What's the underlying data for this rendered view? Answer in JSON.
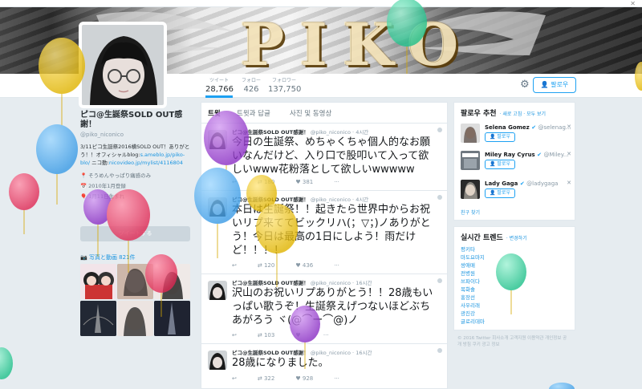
{
  "profile": {
    "name": "ピコ@生誕祭SOLD OUT感謝！",
    "handle": "@piko_niconico",
    "bio": "3/11ピコ生誕祭2016横SOLD OUT！ありがとう！！オフィシャルblog:",
    "bio_link1": "s.ameblo.jp/piko-blo/",
    "bio_mid": " ニコ動:",
    "bio_link2": "nicovideo.jp/mylist/4116804",
    "location": "そうめんやっぱり痛感のみ",
    "join": "2010年1月登録",
    "birth": "1月11日生まれ",
    "tweet_to_button": "ツイートする",
    "photos_label": "写真と動画 821件"
  },
  "banner": {
    "logo_text": "PIKO"
  },
  "stats": [
    {
      "label": "ツイート",
      "value": "28,766"
    },
    {
      "label": "フォロー",
      "value": "426"
    },
    {
      "label": "フォロワー",
      "value": "137,750"
    }
  ],
  "header_actions": {
    "follow_label": "팔로우"
  },
  "tabs": [
    "트윗",
    "트윗과 답글",
    "사진 및 동영상"
  ],
  "tweets": [
    {
      "name": "ピコ@生誕祭SOLD OUT感謝！",
      "handle": "@piko_niconico",
      "time": "4시간",
      "text": "今日の生誕祭、めちゃくちゃ個人的なお願いなんだけど、入り口で股叩いて入って欲しいwww花粉落として欲しいwwwww",
      "retweets": "180",
      "likes": "381"
    },
    {
      "name": "ピコ@生誕祭SOLD OUT感謝！",
      "handle": "@piko_niconico",
      "time": "4시간",
      "text": "本日は生誕祭！！起きたら世界中からお祝いリプ来ててビックリハ(；▽；)ノありがとう！今日は最高の1日にしよう！雨だけど！！！！",
      "retweets": "120",
      "likes": "436"
    },
    {
      "name": "ピコ@生誕祭SOLD OUT感謝！",
      "handle": "@piko_niconico",
      "time": "16시간",
      "text": "沢山のお祝いリプありがとう！！28歳もいっぱい歌うぞ！生誕祭えげつないほどぶちあがろう ヾ(@⌒ー⌒@)ノ",
      "retweets": "103",
      "likes": ""
    },
    {
      "name": "ピコ@生誕祭SOLD OUT感謝！",
      "handle": "@piko_niconico",
      "time": "16시간",
      "text": "28歳になりました。",
      "retweets": "322",
      "likes": "928"
    }
  ],
  "suggestions": {
    "title": "팔로우 추천",
    "links": "· 새로 고침 · 모두 보기",
    "follow_label": "팔로우",
    "find_friends": "친구 찾기",
    "items": [
      {
        "name": "Selena Gomez",
        "handle": "@selenag..."
      },
      {
        "name": "Miley Ray Cyrus",
        "handle": "@Miley..."
      },
      {
        "name": "Lady Gaga",
        "handle": "@ladygaga"
      }
    ]
  },
  "trends": {
    "title": "실시간 트렌드",
    "change": "· 변경하기",
    "items": [
      "평키타",
      "마도요마지",
      "쌍애매",
      "전병원",
      "쓰파이다",
      "목화솔",
      "홍장선",
      "사우리래",
      "광진강",
      "글로리데마"
    ]
  },
  "footer": "© 2016 Twitter  회사소개  고객지원  이용약관  개인정보 공개 방침  쿠키  광고 정보",
  "window": {
    "close_glyph": "✕"
  }
}
